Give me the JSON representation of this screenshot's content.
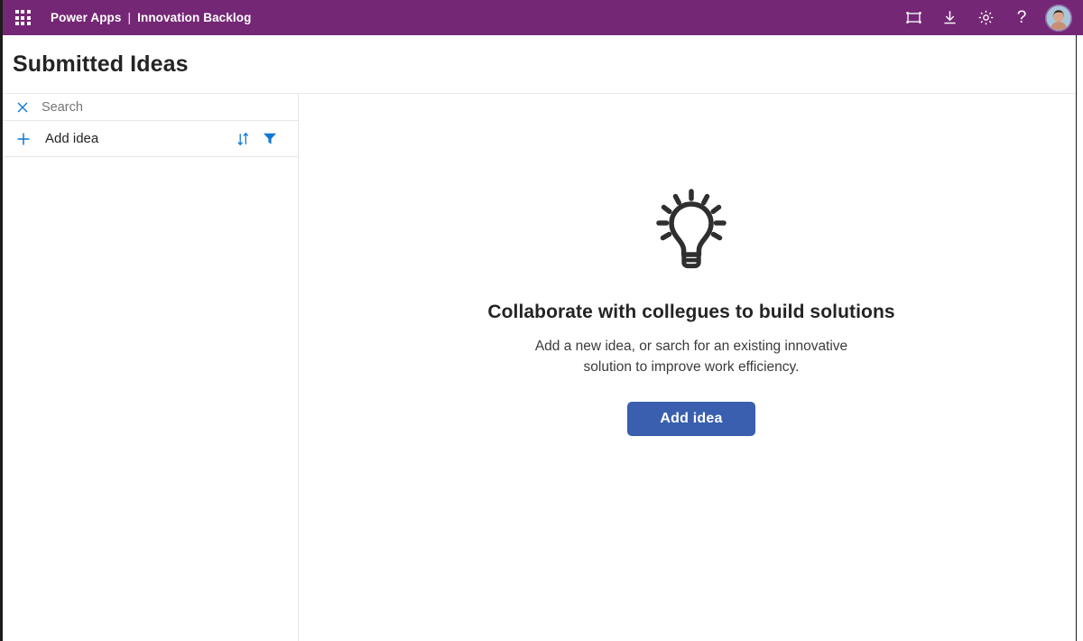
{
  "topbar": {
    "waffle_label": "app-launcher",
    "brand_product": "Power Apps",
    "brand_separator": "|",
    "brand_app": "Innovation Backlog",
    "icons": [
      {
        "name": "edit-canvas-icon",
        "label": "Edit in canvas"
      },
      {
        "name": "download-icon",
        "label": "Download"
      },
      {
        "name": "gear-icon",
        "label": "Settings"
      },
      {
        "name": "help-icon",
        "label": "?"
      }
    ],
    "help_glyph": "?",
    "avatar_label": "User account"
  },
  "header": {
    "title": "Submitted Ideas"
  },
  "sidebar": {
    "search": {
      "placeholder": "Search",
      "clear_icon": "close-icon"
    },
    "add_row": {
      "add_icon": "plus-icon",
      "label": "Add idea",
      "sort_icon": "sort-icon",
      "filter_icon": "filter-icon"
    }
  },
  "main": {
    "illustration": "lightbulb-icon",
    "heading": "Collaborate with collegues to build solutions",
    "description": "Add a new idea, or sarch for an existing innovative solution to improve work efficiency.",
    "primary_button": "Add idea"
  },
  "colors": {
    "brand_purple": "#742774",
    "accent_blue": "#0f78d4",
    "button_blue": "#3a5fae",
    "text_dark": "#242424",
    "text_muted": "#767676",
    "divider": "#e8e8e8"
  }
}
